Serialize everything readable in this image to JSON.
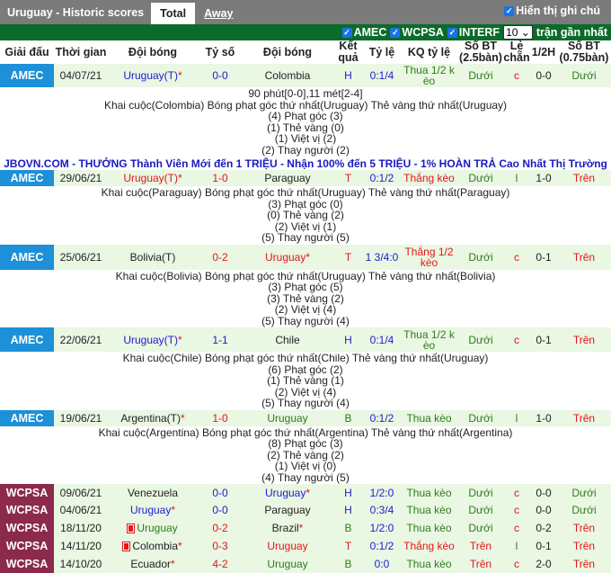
{
  "header": {
    "title": "Uruguay - Historic scores",
    "tabs": [
      "Total",
      "Away"
    ],
    "note_label": "Hiển thị ghi chú"
  },
  "filter": {
    "options": [
      "AMEC",
      "WCPSA",
      "INTERF"
    ],
    "count": "10",
    "suffix": "trận gần nhất"
  },
  "columns": [
    "Giải đấu",
    "Thời gian",
    "Đội bóng",
    "Tỷ số",
    "Đội bóng",
    "Kết quả",
    "Tỷ lệ",
    "KQ tỷ lệ",
    "Số BT (2.5bàn)",
    "Lẻ chẵn",
    "1/2H",
    "Số BT (0.75bàn)"
  ],
  "colors": {
    "AMEC": "#1e90d8",
    "WCPSA": "#8b2a4c",
    "row_bg": "#e9f7e3",
    "filter_bar": "#0b6b2a"
  },
  "banner": "JBOVN.COM - THƯỞNG Thành Viên Mới đến 1 TRIỆU - Nhận 100% đến 5 TRIỆU - 1% HOÀN TRẢ Cao Nhất Thị Trường",
  "matches": [
    {
      "league": "AMEC",
      "date": "04/07/21",
      "home": "Uruguay(T)",
      "home_star": true,
      "home_c": "b",
      "score": "0-0",
      "score_c": "b",
      "away": "Colombia",
      "away_star": false,
      "away_c": "k",
      "res": "H",
      "res_c": "b",
      "odds": "0:1/4",
      "kq": "Thua 1/2 k èo",
      "kq_c": "g",
      "bt": "Dưới",
      "bt_c": "g",
      "lc": "c",
      "lc_c": "r",
      "half": "0-0",
      "bt2": "Dưới",
      "bt2_c": "g",
      "details": [
        "90 phút[0-0],11 mét[2-4]",
        "Khai cuộc(Colombia)  Bóng phạt góc thứ nhất(Uruguay)  Thẻ vàng thứ nhất(Uruguay)",
        "(4) Phạt góc (3)",
        "(1) Thẻ vàng (0)",
        "(1) Việt vị (2)",
        "(2) Thay người (2)"
      ]
    },
    {
      "league": "AMEC",
      "date": "29/06/21",
      "home": "Uruguay(T)",
      "home_star": true,
      "home_c": "r",
      "score": "1-0",
      "score_c": "r",
      "away": "Paraguay",
      "away_star": false,
      "away_c": "k",
      "res": "T",
      "res_c": "r",
      "odds": "0:1/2",
      "kq": "Thắng kèo",
      "kq_c": "r",
      "bt": "Dưới",
      "bt_c": "g",
      "lc": "l",
      "lc_c": "g",
      "half": "1-0",
      "bt2": "Trên",
      "bt2_c": "r",
      "details": [
        "Khai cuộc(Paraguay)  Bóng phạt góc thứ nhất(Uruguay)  Thẻ vàng thứ nhất(Paraguay)",
        "(3) Phạt góc (0)",
        "(0) Thẻ vàng (2)",
        "(2) Việt vị (1)",
        "(5) Thay người (5)"
      ]
    },
    {
      "league": "AMEC",
      "date": "25/06/21",
      "home": "Bolivia(T)",
      "home_star": false,
      "home_c": "k",
      "score": "0-2",
      "score_c": "r",
      "away": "Uruguay",
      "away_star": true,
      "away_c": "r",
      "res": "T",
      "res_c": "r",
      "odds": "1 3/4:0",
      "kq": "Thắng 1/2 kèo",
      "kq_c": "r",
      "bt": "Dưới",
      "bt_c": "g",
      "lc": "c",
      "lc_c": "r",
      "half": "0-1",
      "bt2": "Trên",
      "bt2_c": "r",
      "details": [
        "Khai cuộc(Bolivia)  Bóng phạt góc thứ nhất(Uruguay)  Thẻ vàng thứ nhất(Bolivia)",
        "(3) Phạt góc (5)",
        "(3) Thẻ vàng (2)",
        "(2) Việt vị (4)",
        "(5) Thay người (4)"
      ]
    },
    {
      "league": "AMEC",
      "date": "22/06/21",
      "home": "Uruguay(T)",
      "home_star": true,
      "home_c": "b",
      "score": "1-1",
      "score_c": "b",
      "away": "Chile",
      "away_star": false,
      "away_c": "k",
      "res": "H",
      "res_c": "b",
      "odds": "0:1/4",
      "kq": "Thua 1/2 k èo",
      "kq_c": "g",
      "bt": "Dưới",
      "bt_c": "g",
      "lc": "c",
      "lc_c": "r",
      "half": "0-1",
      "bt2": "Trên",
      "bt2_c": "r",
      "details": [
        "Khai cuộc(Chile)  Bóng phạt góc thứ nhất(Chile)  Thẻ vàng thứ nhất(Uruguay)",
        "(6) Phạt góc (2)",
        "(1) Thẻ vàng (1)",
        "(2) Việt vị (4)",
        "(5) Thay người (4)"
      ]
    },
    {
      "league": "AMEC",
      "date": "19/06/21",
      "home": "Argentina(T)",
      "home_star": true,
      "home_c": "k",
      "score": "1-0",
      "score_c": "r",
      "away": "Uruguay",
      "away_star": false,
      "away_c": "g",
      "res": "B",
      "res_c": "g",
      "odds": "0:1/2",
      "kq": "Thua kèo",
      "kq_c": "g",
      "bt": "Dưới",
      "bt_c": "g",
      "lc": "l",
      "lc_c": "g",
      "half": "1-0",
      "bt2": "Trên",
      "bt2_c": "r",
      "details": [
        "Khai cuộc(Argentina)  Bóng phạt góc thứ nhất(Argentina)  Thẻ vàng thứ nhất(Argentina)",
        "(8) Phạt góc (3)",
        "(2) Thẻ vàng (2)",
        "(1) Việt vị (0)",
        "(4) Thay người (5)"
      ]
    },
    {
      "league": "WCPSA",
      "date": "09/06/21",
      "home": "Venezuela",
      "home_star": false,
      "home_c": "k",
      "score": "0-0",
      "score_c": "b",
      "away": "Uruguay",
      "away_star": true,
      "away_c": "b",
      "res": "H",
      "res_c": "b",
      "odds": "1/2:0",
      "kq": "Thua kèo",
      "kq_c": "g",
      "bt": "Dưới",
      "bt_c": "g",
      "lc": "c",
      "lc_c": "r",
      "half": "0-0",
      "bt2": "Dưới",
      "bt2_c": "g",
      "details": []
    },
    {
      "league": "WCPSA",
      "date": "04/06/21",
      "home": "Uruguay",
      "home_star": true,
      "home_c": "b",
      "score": "0-0",
      "score_c": "b",
      "away": "Paraguay",
      "away_star": false,
      "away_c": "k",
      "res": "H",
      "res_c": "b",
      "odds": "0:3/4",
      "kq": "Thua kèo",
      "kq_c": "g",
      "bt": "Dưới",
      "bt_c": "g",
      "lc": "c",
      "lc_c": "r",
      "half": "0-0",
      "bt2": "Dưới",
      "bt2_c": "g",
      "details": []
    },
    {
      "league": "WCPSA",
      "date": "18/11/20",
      "home": "Uruguay",
      "home_flag": true,
      "home_star": false,
      "home_c": "g",
      "score": "0-2",
      "score_c": "r",
      "away": "Brazil",
      "away_star": true,
      "away_c": "k",
      "res": "B",
      "res_c": "g",
      "odds": "1/2:0",
      "kq": "Thua kèo",
      "kq_c": "g",
      "bt": "Dưới",
      "bt_c": "g",
      "lc": "c",
      "lc_c": "r",
      "half": "0-2",
      "bt2": "Trên",
      "bt2_c": "r",
      "details": []
    },
    {
      "league": "WCPSA",
      "date": "14/11/20",
      "home": "Colombia",
      "home_flag": true,
      "home_star": true,
      "home_c": "k",
      "score": "0-3",
      "score_c": "r",
      "away": "Uruguay",
      "away_star": false,
      "away_c": "r",
      "res": "T",
      "res_c": "r",
      "odds": "0:1/2",
      "kq": "Thắng kèo",
      "kq_c": "r",
      "bt": "Trên",
      "bt_c": "r",
      "lc": "l",
      "lc_c": "g",
      "half": "0-1",
      "bt2": "Trên",
      "bt2_c": "r",
      "details": []
    },
    {
      "league": "WCPSA",
      "date": "14/10/20",
      "home": "Ecuador",
      "home_star": true,
      "home_c": "k",
      "score": "4-2",
      "score_c": "r",
      "away": "Uruguay",
      "away_star": false,
      "away_c": "g",
      "res": "B",
      "res_c": "g",
      "odds": "0:0",
      "kq": "Thua kèo",
      "kq_c": "g",
      "bt": "Trên",
      "bt_c": "r",
      "lc": "c",
      "lc_c": "r",
      "half": "2-0",
      "bt2": "Trên",
      "bt2_c": "r",
      "details": []
    }
  ]
}
